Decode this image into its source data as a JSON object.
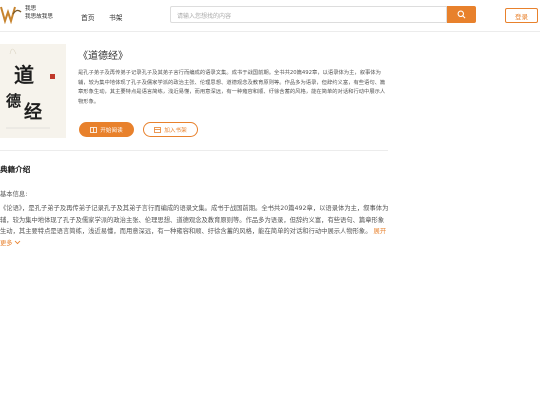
{
  "header": {
    "site_name_line1": "我思",
    "site_name_line2": "我思故我思",
    "nav": [
      "首页",
      "书架"
    ],
    "search_placeholder": "请输入您想找的内容",
    "login_label": "登录"
  },
  "book": {
    "title": "《道德经》",
    "cover_text": "道德经",
    "description": "是孔子弟子及再传弟子记录孔子及其弟子言行而编成的语录文集。成书于战国前期。全书共20篇492章，以语录体为主，叙事体为辅，较为集中地体现了孔子及儒家学派的政治主张、伦理思想、道德观念及教育原则等。作品多为语录，但辞约义富，有些语句、篇章形象生动，其主要特点是语言简练，浅近易懂，而用意深远，有一种雍容和顺、纡徐含蓄的风格，能在简单的对话和行动中展示人物形象。",
    "read_button": "开始阅读",
    "shelf_button": "加入书架"
  },
  "intro": {
    "section_title": "典籍介绍",
    "label": "基本信息:",
    "text": "《论语》，是孔子弟子及再传弟子记录孔子及其弟子言行而编成的语录文集。成书于战国前期。全书共20篇492章，以语录体为主，叙事体为辅，较为集中地体现了孔子及儒家学派的政治主张、伦理思想、道德观念及教育原则等。作品多为语录，但辞约义富，有些语句、篇章形象生动，其主要特点是语言简练，浅近易懂，而用意深远，有一种雍容和顺、纡徐含蓄的风格，能在简单的对话和行动中展示人物形象。",
    "expand_label": "展开更多"
  },
  "colors": {
    "accent": "#e8812c"
  }
}
